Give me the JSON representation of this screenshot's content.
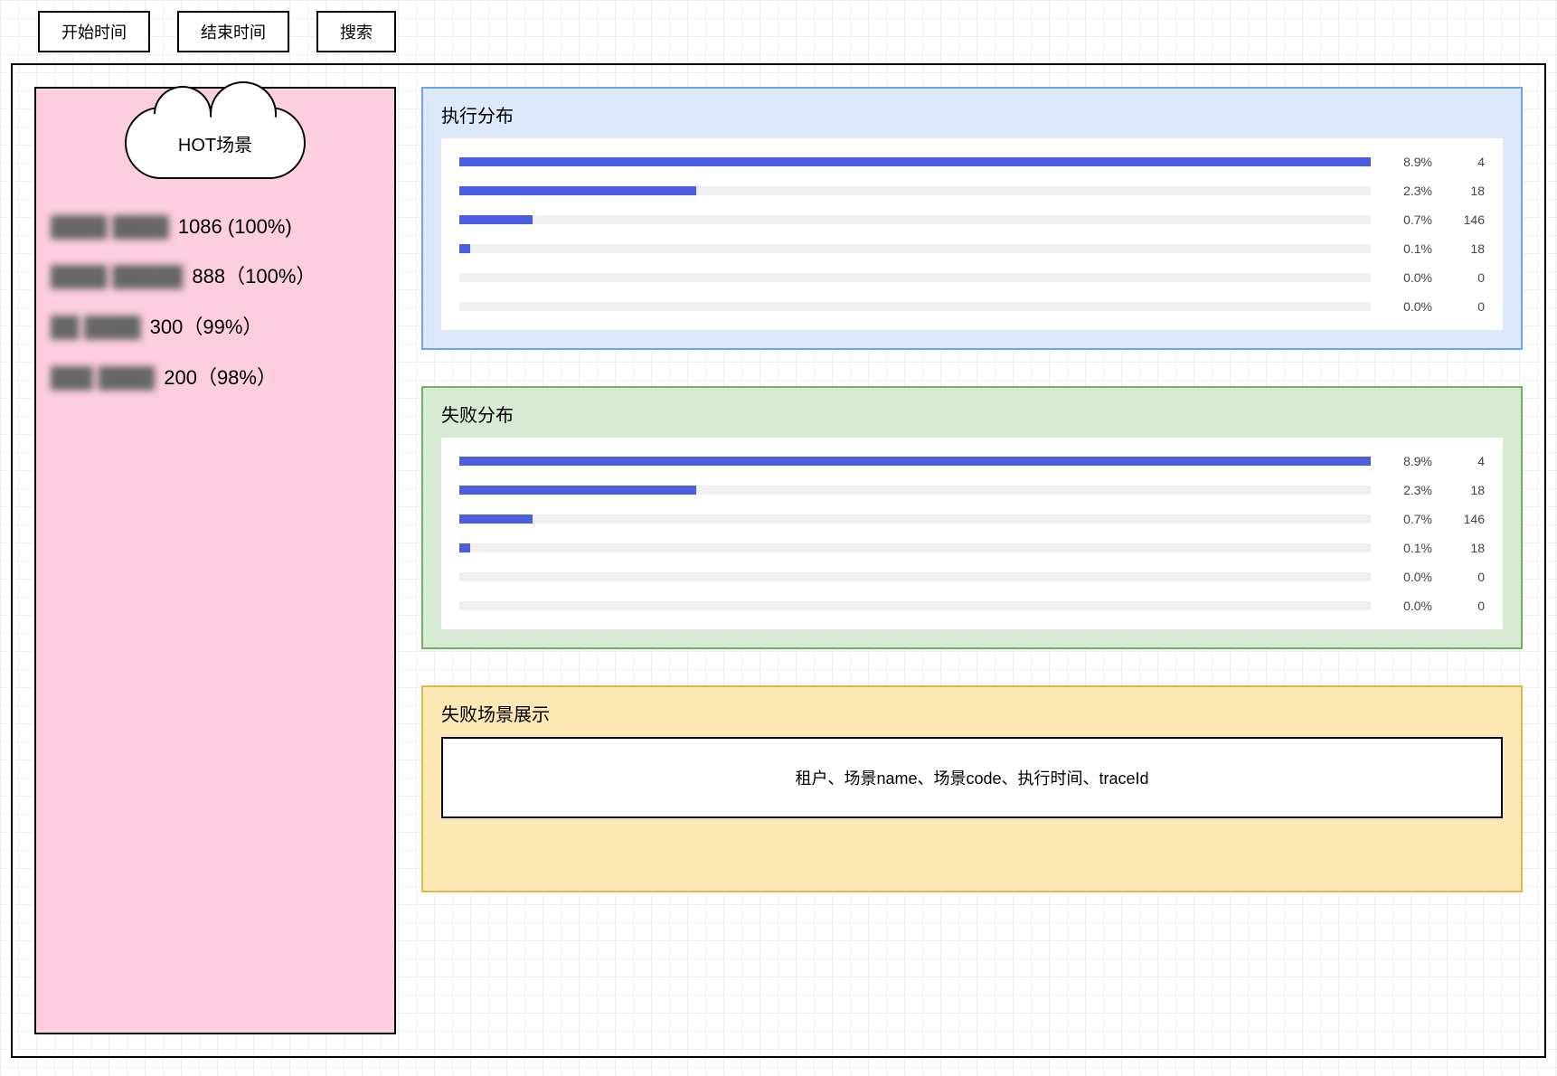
{
  "toolbar": {
    "start_time_label": "开始时间",
    "end_time_label": "结束时间",
    "search_label": "搜索"
  },
  "sidebar": {
    "title": "HOT场景",
    "items": [
      {
        "name_masked": "████ ████",
        "value": "1086 (100%)"
      },
      {
        "name_masked": "████ █████",
        "value": "888（100%）"
      },
      {
        "name_masked": "██ ████",
        "value": "300（99%）"
      },
      {
        "name_masked": "███ ████",
        "value": "200（98%）"
      }
    ]
  },
  "panels": {
    "execution": {
      "title": "执行分布"
    },
    "failure": {
      "title": "失败分布"
    },
    "failure_scene": {
      "title": "失败场景展示",
      "row_label": "租户、场景name、场景code、执行时间、traceId"
    }
  },
  "chart_data": [
    {
      "type": "bar",
      "title": "执行分布",
      "orientation": "horizontal",
      "x_unit": "percent",
      "rows": [
        {
          "percent": 8.9,
          "count": 4,
          "bar_width_pct": 100
        },
        {
          "percent": 2.3,
          "count": 18,
          "bar_width_pct": 26
        },
        {
          "percent": 0.7,
          "count": 146,
          "bar_width_pct": 8
        },
        {
          "percent": 0.1,
          "count": 18,
          "bar_width_pct": 1.2
        },
        {
          "percent": 0.0,
          "count": 0,
          "bar_width_pct": 0
        },
        {
          "percent": 0.0,
          "count": 0,
          "bar_width_pct": 0
        }
      ]
    },
    {
      "type": "bar",
      "title": "失败分布",
      "orientation": "horizontal",
      "x_unit": "percent",
      "rows": [
        {
          "percent": 8.9,
          "count": 4,
          "bar_width_pct": 100
        },
        {
          "percent": 2.3,
          "count": 18,
          "bar_width_pct": 26
        },
        {
          "percent": 0.7,
          "count": 146,
          "bar_width_pct": 8
        },
        {
          "percent": 0.1,
          "count": 18,
          "bar_width_pct": 1.2
        },
        {
          "percent": 0.0,
          "count": 0,
          "bar_width_pct": 0
        },
        {
          "percent": 0.0,
          "count": 0,
          "bar_width_pct": 0
        }
      ]
    }
  ]
}
